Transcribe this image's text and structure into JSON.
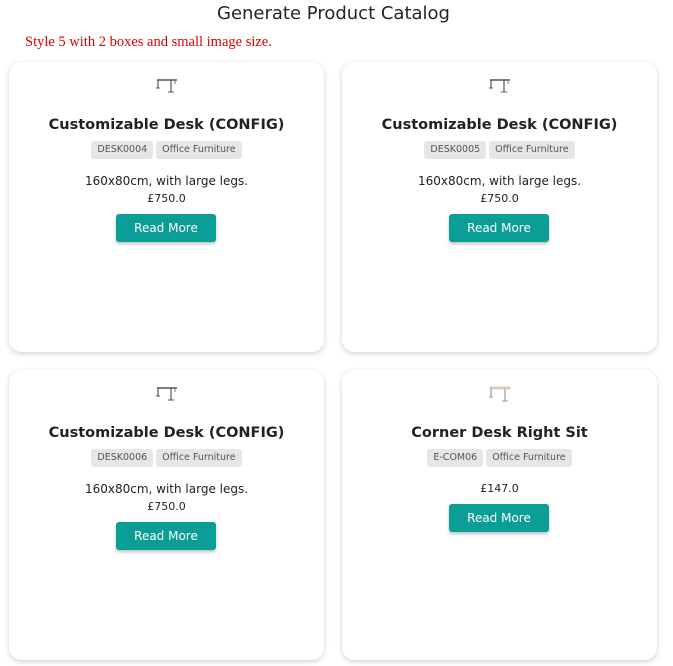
{
  "page": {
    "title": "Generate Product Catalog",
    "subtitle": "Style 5 with 2 boxes and small image size."
  },
  "cards": [
    {
      "name": "Customizable Desk (CONFIG)",
      "sku": "DESK0004",
      "category": "Office Furniture",
      "description": "160x80cm, with large legs.",
      "price": "£750.0",
      "button": "Read More",
      "image_icon": "desk-icon"
    },
    {
      "name": "Customizable Desk (CONFIG)",
      "sku": "DESK0005",
      "category": "Office Furniture",
      "description": "160x80cm, with large legs.",
      "price": "£750.0",
      "button": "Read More",
      "image_icon": "desk-icon"
    },
    {
      "name": "Customizable Desk (CONFIG)",
      "sku": "DESK0006",
      "category": "Office Furniture",
      "description": "160x80cm, with large legs.",
      "price": "£750.0",
      "button": "Read More",
      "image_icon": "desk-icon"
    },
    {
      "name": "Corner Desk Right Sit",
      "sku": "E-COM06",
      "category": "Office Furniture",
      "price": "£147.0",
      "button": "Read More",
      "image_icon": "corner-desk-icon"
    }
  ],
  "colors": {
    "button_bg": "#0b9e96",
    "subtitle": "#e00000",
    "tag_bg": "#e6e6e6"
  }
}
